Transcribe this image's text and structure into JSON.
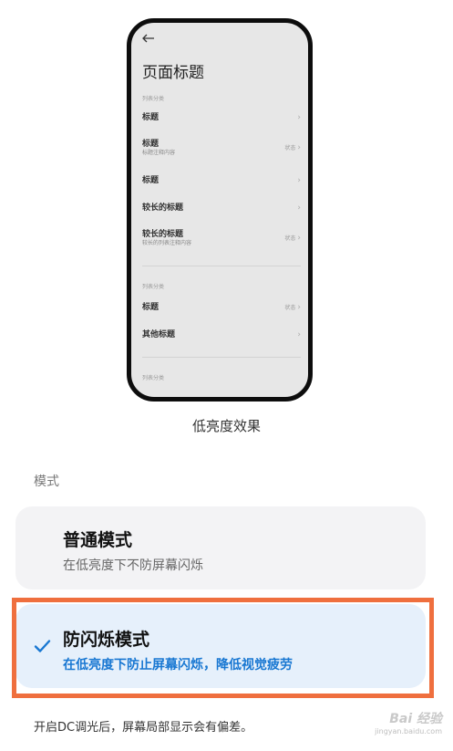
{
  "preview": {
    "back_icon": "arrow-left-icon",
    "page_title": "页面标题",
    "group1_label": "列表分类",
    "items_group1": [
      {
        "title": "标题",
        "subtitle": "",
        "status": ""
      },
      {
        "title": "标题",
        "subtitle": "标题注释内容",
        "status": "状态"
      },
      {
        "title": "标题",
        "subtitle": "",
        "status": ""
      },
      {
        "title": "较长的标题",
        "subtitle": "",
        "status": ""
      },
      {
        "title": "较长的标题",
        "subtitle": "较长的列表注释内容",
        "status": "状态"
      }
    ],
    "group2_label": "列表分类",
    "items_group2": [
      {
        "title": "标题",
        "subtitle": "",
        "status": "状态"
      },
      {
        "title": "其他标题",
        "subtitle": "",
        "status": ""
      }
    ],
    "group3_label": "列表分类",
    "caption": "低亮度效果"
  },
  "mode": {
    "section_label": "模式",
    "options": [
      {
        "title": "普通模式",
        "description": "在低亮度下不防屏幕闪烁",
        "selected": false
      },
      {
        "title": "防闪烁模式",
        "description": "在低亮度下防止屏幕闪烁，降低视觉疲劳",
        "selected": true
      }
    ],
    "accent_color": "#1877d2",
    "highlight_color": "#ef6f3e"
  },
  "footer_note": "开启DC调光后，屏幕局部显示会有偏差。",
  "watermark": {
    "line1": "Bai 经验",
    "line2": "jingyan.baidu.com"
  }
}
